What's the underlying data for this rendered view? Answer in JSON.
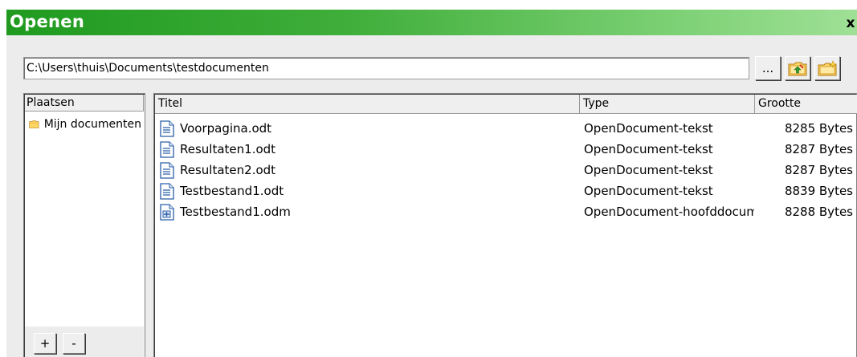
{
  "window": {
    "title": "Openen",
    "close_label": "x"
  },
  "location": {
    "path": "C:\\Users\\thuis\\Documents\\testdocumenten",
    "browse_label": "...",
    "up_icon": "folder-up-icon",
    "new_folder_icon": "new-folder-icon"
  },
  "places": {
    "header": "Plaatsen",
    "items": [
      {
        "label": "Mijn documenten",
        "icon": "folder-icon"
      }
    ],
    "add_label": "+",
    "remove_label": "-"
  },
  "files": {
    "columns": {
      "title": "Titel",
      "type": "Type",
      "size": "Grootte"
    },
    "rows": [
      {
        "name": "Voorpagina.odt",
        "type": "OpenDocument-tekst",
        "size": "8285 Bytes",
        "icon": "text-document-icon"
      },
      {
        "name": "Resultaten1.odt",
        "type": "OpenDocument-tekst",
        "size": "8287 Bytes",
        "icon": "text-document-icon"
      },
      {
        "name": "Resultaten2.odt",
        "type": "OpenDocument-tekst",
        "size": "8287 Bytes",
        "icon": "text-document-icon"
      },
      {
        "name": "Testbestand1.odt",
        "type": "OpenDocument-tekst",
        "size": "8839 Bytes",
        "icon": "text-document-icon"
      },
      {
        "name": "Testbestand1.odm",
        "type": "OpenDocument-hoofddocument",
        "size": "8288 Bytes",
        "icon": "master-document-icon"
      }
    ]
  },
  "colors": {
    "titlebar_start": "#1f9a1f",
    "titlebar_end": "#9fe096",
    "dialog_background": "#ececec",
    "folder_fill": "#ffd766",
    "document_icon_blue": "#2b5fa8"
  }
}
